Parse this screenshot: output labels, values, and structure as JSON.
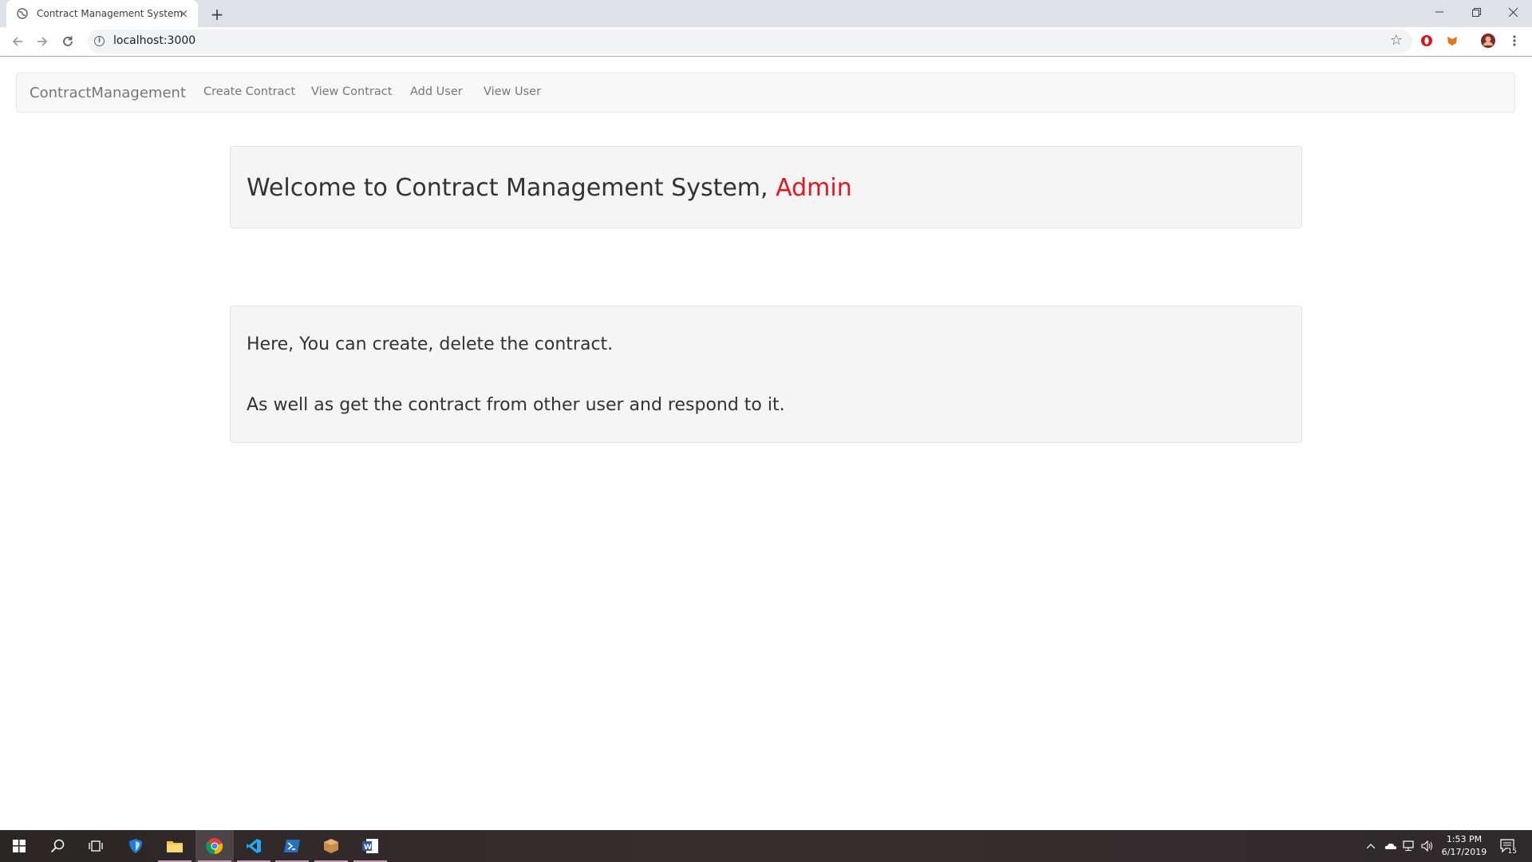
{
  "browser": {
    "tab_title": "Contract Management System",
    "tab_close": "×",
    "new_tab": "+",
    "url": "localhost:3000",
    "info_symbol": "i",
    "bookmark_star": "☆"
  },
  "navbar": {
    "brand": "ContractManagement",
    "links": [
      "Create Contract",
      "View Contract",
      "Add User",
      "View User"
    ]
  },
  "welcome": {
    "prefix": "Welcome to Contract Management System, ",
    "user": "Admin",
    "user_color": "#e1191e"
  },
  "info": {
    "line1": "Here, You can create, delete the contract.",
    "line2": "As well as get the contract from other user and respond to it."
  },
  "taskbar": {
    "time": "1:53 PM",
    "date": "6/17/2019",
    "notifications": "15",
    "pinned_icons": [
      "windows-start-icon",
      "search-icon",
      "task-view-icon",
      "defender-icon",
      "file-explorer-icon",
      "chrome-icon",
      "vscode-icon",
      "powershell-icon",
      "package-icon",
      "word-icon"
    ]
  }
}
